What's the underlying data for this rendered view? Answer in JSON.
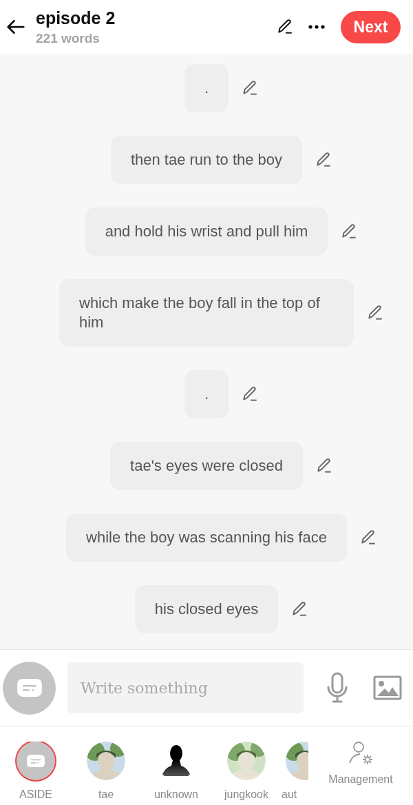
{
  "header": {
    "title": "episode 2",
    "word_count": "221 words",
    "next_button": "Next"
  },
  "messages": [
    {
      "text": "."
    },
    {
      "text": "then tae run to the boy"
    },
    {
      "text": "and hold his wrist and pull him"
    },
    {
      "text": "which make the boy fall in the top of him"
    },
    {
      "text": "."
    },
    {
      "text": "tae's eyes were closed"
    },
    {
      "text": "while the boy was scanning his face"
    },
    {
      "text": "his closed eyes"
    }
  ],
  "composer": {
    "placeholder": "Write something"
  },
  "characters": [
    {
      "name": "ASIDE",
      "kind": "aside",
      "selected": true
    },
    {
      "name": "tae",
      "selected": false
    },
    {
      "name": "unknown",
      "kind": "silhouette",
      "selected": false
    },
    {
      "name": "jungkook",
      "selected": false
    },
    {
      "name": "aut",
      "selected": false
    }
  ],
  "management": "Management"
}
